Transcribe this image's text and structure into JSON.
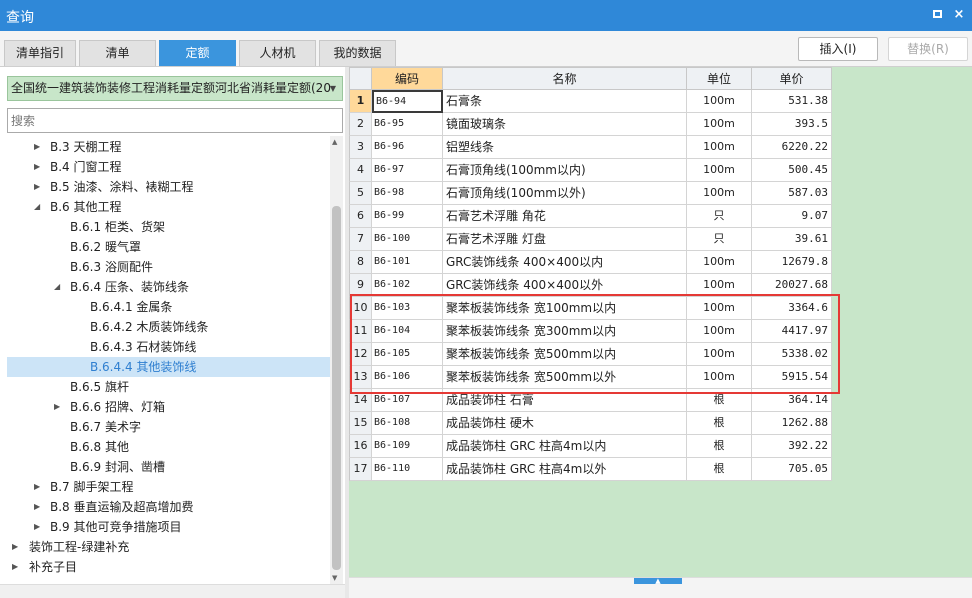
{
  "window": {
    "title": "查询",
    "restore": "restore",
    "close": "×"
  },
  "tabs": [
    {
      "label": "清单指引",
      "active": false
    },
    {
      "label": "清单",
      "active": false
    },
    {
      "label": "定额",
      "active": true
    },
    {
      "label": "人材机",
      "active": false
    },
    {
      "label": "我的数据",
      "active": false
    }
  ],
  "toolbar": {
    "insert_label": "插入(I)",
    "replace_label": "替换(R)"
  },
  "quota_library": {
    "value": "全国统一建筑装饰装修工程消耗量定额河北省消耗量定额(20"
  },
  "search": {
    "placeholder": "搜索"
  },
  "tree": [
    {
      "label": "B.3 天棚工程",
      "level": 1,
      "caret": "▶"
    },
    {
      "label": "B.4 门窗工程",
      "level": 1,
      "caret": "▶"
    },
    {
      "label": "B.5 油漆、涂料、裱糊工程",
      "level": 1,
      "caret": "▶"
    },
    {
      "label": "B.6 其他工程",
      "level": 1,
      "caret": "◢"
    },
    {
      "label": "B.6.1 柜类、货架",
      "level": 2,
      "caret": ""
    },
    {
      "label": "B.6.2 暖气罩",
      "level": 2,
      "caret": ""
    },
    {
      "label": "B.6.3 浴厕配件",
      "level": 2,
      "caret": ""
    },
    {
      "label": "B.6.4 压条、装饰线条",
      "level": 2,
      "caret": "◢"
    },
    {
      "label": "B.6.4.1 金属条",
      "level": 3,
      "caret": ""
    },
    {
      "label": "B.6.4.2 木质装饰线条",
      "level": 3,
      "caret": ""
    },
    {
      "label": "B.6.4.3 石材装饰线",
      "level": 3,
      "caret": ""
    },
    {
      "label": "B.6.4.4 其他装饰线",
      "level": 3,
      "caret": "",
      "selected": true
    },
    {
      "label": "B.6.5 旗杆",
      "level": 2,
      "caret": ""
    },
    {
      "label": "B.6.6 招牌、灯箱",
      "level": 2,
      "caret": "▶"
    },
    {
      "label": "B.6.7 美术字",
      "level": 2,
      "caret": ""
    },
    {
      "label": "B.6.8 其他",
      "level": 2,
      "caret": ""
    },
    {
      "label": "B.6.9 封洞、凿槽",
      "level": 2,
      "caret": ""
    },
    {
      "label": "B.7 脚手架工程",
      "level": 1,
      "caret": "▶"
    },
    {
      "label": "B.8 垂直运输及超高增加费",
      "level": 1,
      "caret": "▶"
    },
    {
      "label": "B.9 其他可竞争措施项目",
      "level": 1,
      "caret": "▶"
    },
    {
      "label": "装饰工程-绿建补充",
      "level": 0,
      "caret": "▶"
    },
    {
      "label": "补充子目",
      "level": 0,
      "caret": "▶"
    }
  ],
  "grid": {
    "headers": {
      "code": "编码",
      "name": "名称",
      "unit": "单位",
      "price": "单价"
    },
    "rows": [
      {
        "no": "1",
        "code": "B6-94",
        "name": "石膏条",
        "unit": "100m",
        "price": "531.38"
      },
      {
        "no": "2",
        "code": "B6-95",
        "name": "镜面玻璃条",
        "unit": "100m",
        "price": "393.5"
      },
      {
        "no": "3",
        "code": "B6-96",
        "name": "铝塑线条",
        "unit": "100m",
        "price": "6220.22"
      },
      {
        "no": "4",
        "code": "B6-97",
        "name": "石膏顶角线(100mm以内)",
        "unit": "100m",
        "price": "500.45"
      },
      {
        "no": "5",
        "code": "B6-98",
        "name": "石膏顶角线(100mm以外)",
        "unit": "100m",
        "price": "587.03"
      },
      {
        "no": "6",
        "code": "B6-99",
        "name": "石膏艺术浮雕 角花",
        "unit": "只",
        "price": "9.07"
      },
      {
        "no": "7",
        "code": "B6-100",
        "name": "石膏艺术浮雕 灯盘",
        "unit": "只",
        "price": "39.61"
      },
      {
        "no": "8",
        "code": "B6-101",
        "name": "GRC装饰线条 400×400以内",
        "unit": "100m",
        "price": "12679.8"
      },
      {
        "no": "9",
        "code": "B6-102",
        "name": "GRC装饰线条 400×400以外",
        "unit": "100m",
        "price": "20027.68"
      },
      {
        "no": "10",
        "code": "B6-103",
        "name": "聚苯板装饰线条 宽100mm以内",
        "unit": "100m",
        "price": "3364.6"
      },
      {
        "no": "11",
        "code": "B6-104",
        "name": "聚苯板装饰线条 宽300mm以内",
        "unit": "100m",
        "price": "4417.97"
      },
      {
        "no": "12",
        "code": "B6-105",
        "name": "聚苯板装饰线条 宽500mm以内",
        "unit": "100m",
        "price": "5338.02"
      },
      {
        "no": "13",
        "code": "B6-106",
        "name": "聚苯板装饰线条 宽500mm以外",
        "unit": "100m",
        "price": "5915.54"
      },
      {
        "no": "14",
        "code": "B6-107",
        "name": "成品装饰柱 石膏",
        "unit": "根",
        "price": "364.14"
      },
      {
        "no": "15",
        "code": "B6-108",
        "name": "成品装饰柱 硬木",
        "unit": "根",
        "price": "1262.88"
      },
      {
        "no": "16",
        "code": "B6-109",
        "name": "成品装饰柱 GRC 柱高4m以内",
        "unit": "根",
        "price": "392.22"
      },
      {
        "no": "17",
        "code": "B6-110",
        "name": "成品装饰柱 GRC 柱高4m以外",
        "unit": "根",
        "price": "705.05"
      }
    ]
  },
  "colors": {
    "accent": "#3b95dd",
    "title_bar": "#2f88d8",
    "grid_bg": "#c8e6c9",
    "highlight": "#e53935",
    "selected_header": "#ffd99a"
  }
}
